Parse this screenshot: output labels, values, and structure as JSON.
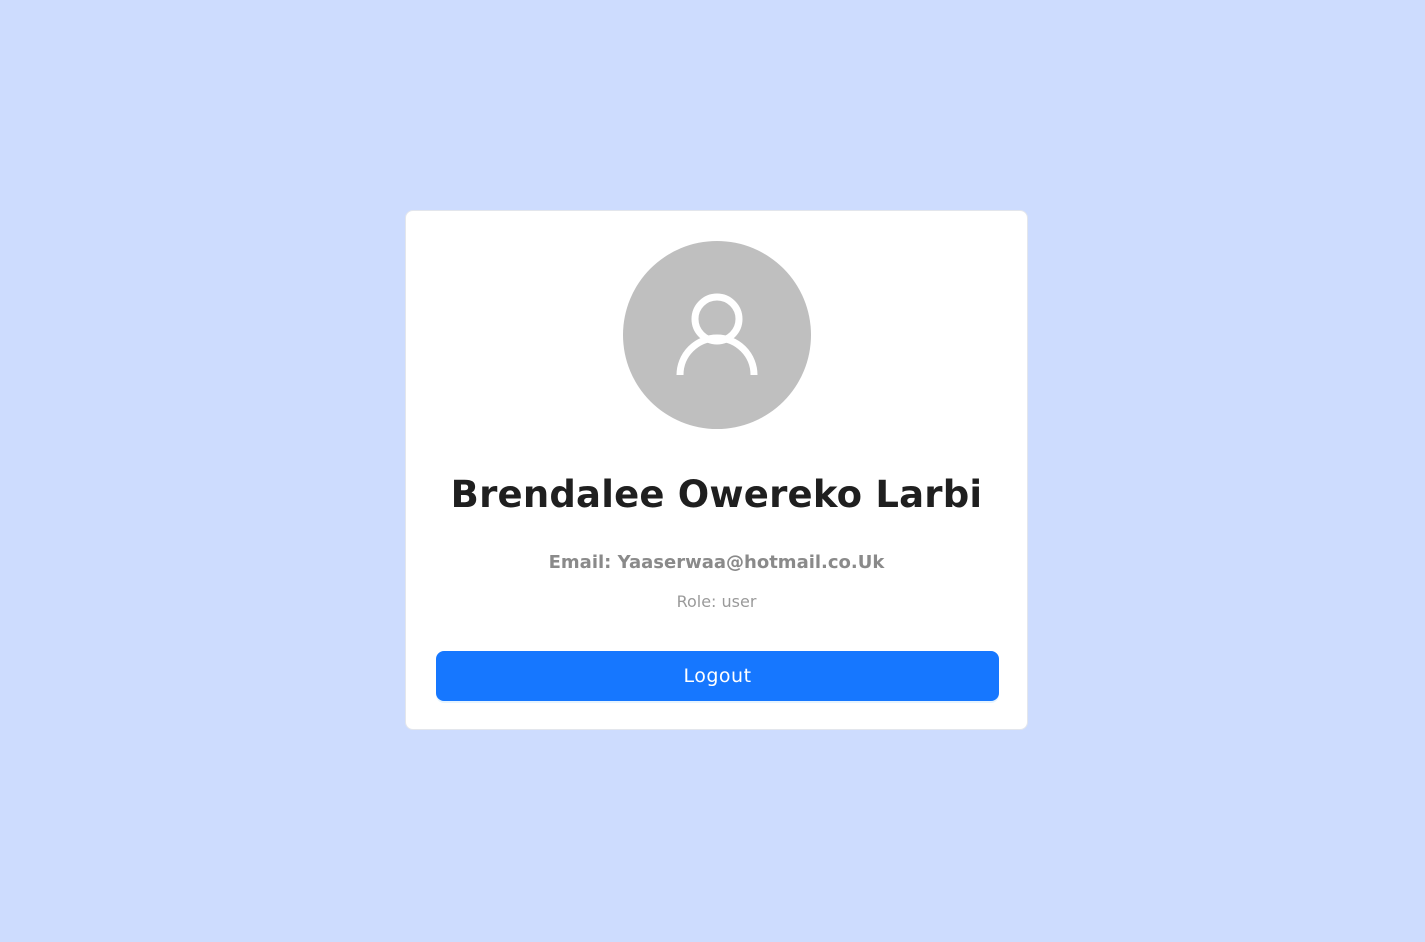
{
  "profile": {
    "avatar_icon": "user-icon",
    "name": "Brendalee Owereko Larbi",
    "email_line": "Email: Yaaserwaa@hotmail.co.Uk",
    "role_line": "Role: user"
  },
  "actions": {
    "logout_label": "Logout"
  },
  "colors": {
    "background": "#cddcfe",
    "card": "#ffffff",
    "avatar": "#bfbfbf",
    "primary_button": "#1677ff"
  }
}
